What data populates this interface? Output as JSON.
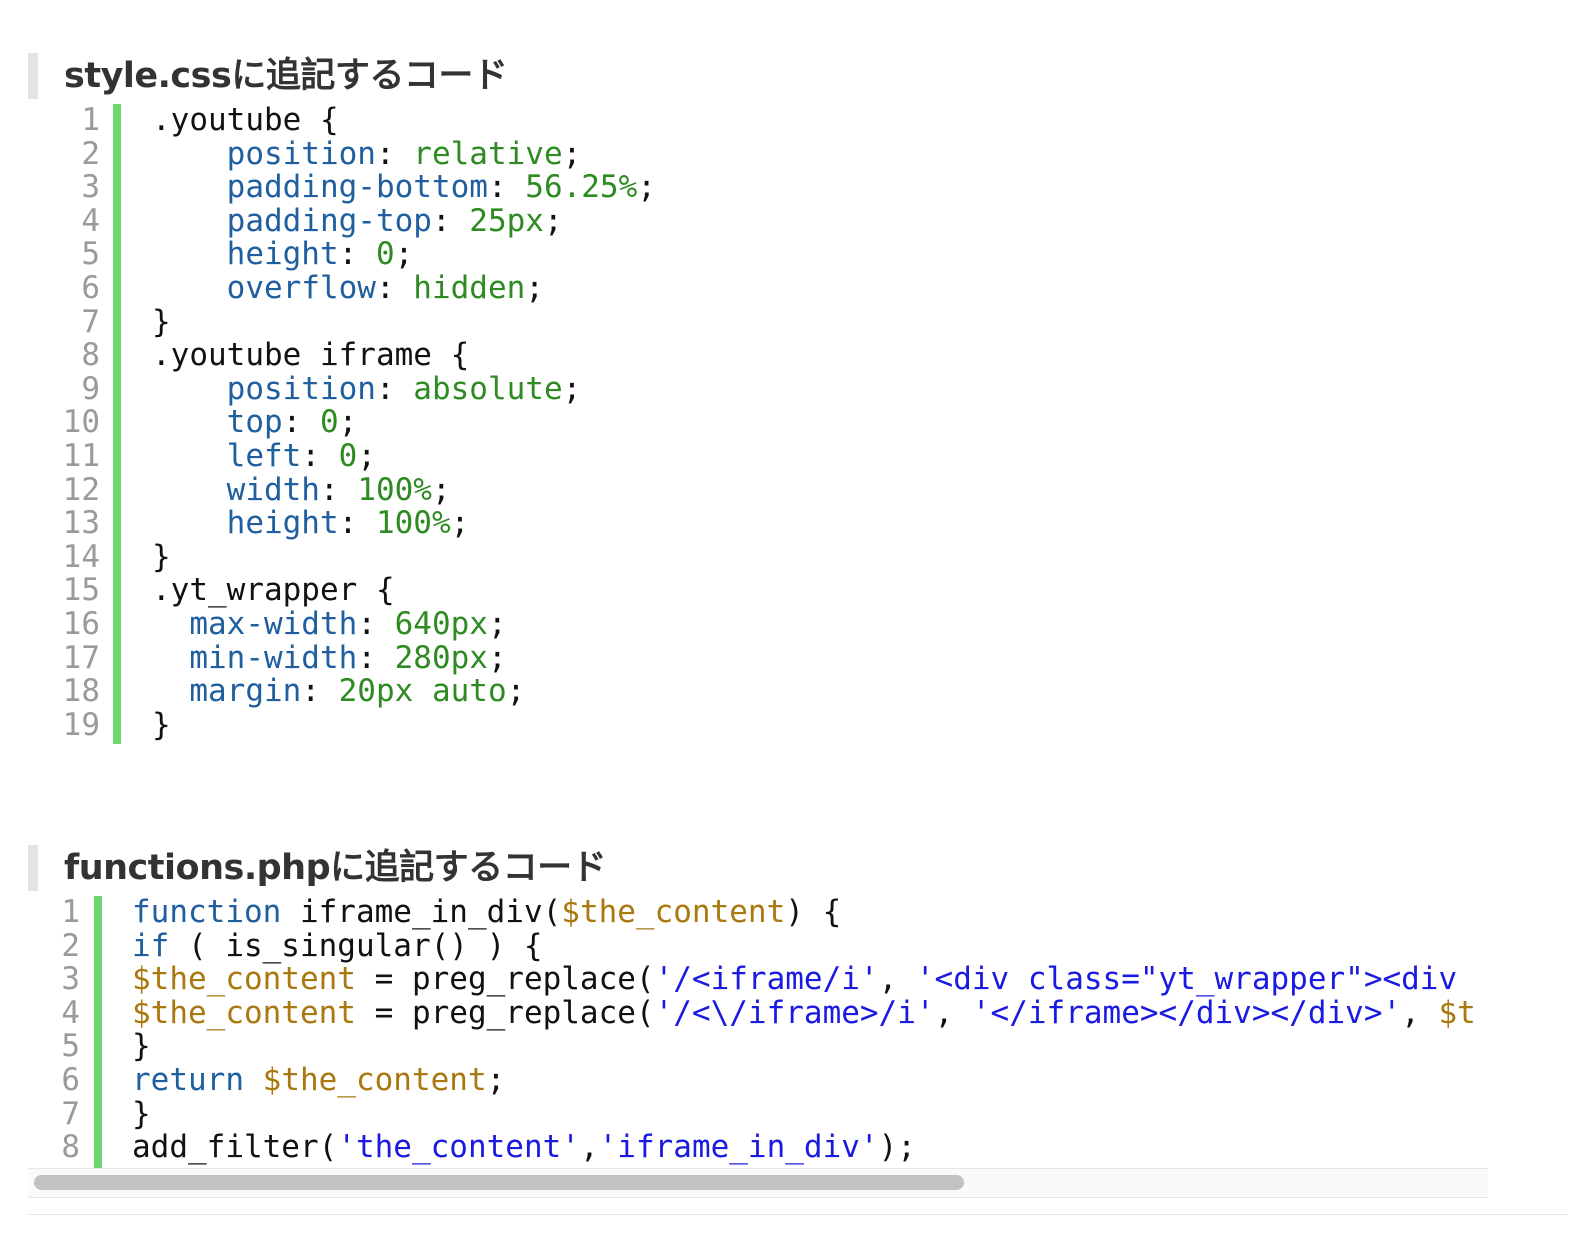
{
  "headings": {
    "css": "style.cssに追記するコード",
    "php": "functions.phpに追記するコード"
  },
  "css_code": {
    "line_numbers": [
      "1",
      "2",
      "3",
      "4",
      "5",
      "6",
      "7",
      "8",
      "9",
      "10",
      "11",
      "12",
      "13",
      "14",
      "15",
      "16",
      "17",
      "18",
      "19"
    ],
    "lines": [
      [
        {
          "t": ".youtube {",
          "c": ""
        }
      ],
      [
        {
          "t": "    ",
          "c": ""
        },
        {
          "t": "position",
          "c": "p"
        },
        {
          "t": ": ",
          "c": ""
        },
        {
          "t": "relative",
          "c": "v"
        },
        {
          "t": ";",
          "c": ""
        }
      ],
      [
        {
          "t": "    ",
          "c": ""
        },
        {
          "t": "padding-bottom",
          "c": "p"
        },
        {
          "t": ": ",
          "c": ""
        },
        {
          "t": "56.25%",
          "c": "v"
        },
        {
          "t": ";",
          "c": ""
        }
      ],
      [
        {
          "t": "    ",
          "c": ""
        },
        {
          "t": "padding-top",
          "c": "p"
        },
        {
          "t": ": ",
          "c": ""
        },
        {
          "t": "25px",
          "c": "v"
        },
        {
          "t": ";",
          "c": ""
        }
      ],
      [
        {
          "t": "    ",
          "c": ""
        },
        {
          "t": "height",
          "c": "p"
        },
        {
          "t": ": ",
          "c": ""
        },
        {
          "t": "0",
          "c": "v"
        },
        {
          "t": ";",
          "c": ""
        }
      ],
      [
        {
          "t": "    ",
          "c": ""
        },
        {
          "t": "overflow",
          "c": "p"
        },
        {
          "t": ": ",
          "c": ""
        },
        {
          "t": "hidden",
          "c": "v"
        },
        {
          "t": ";",
          "c": ""
        }
      ],
      [
        {
          "t": "}",
          "c": ""
        }
      ],
      [
        {
          "t": ".youtube iframe {",
          "c": ""
        }
      ],
      [
        {
          "t": "    ",
          "c": ""
        },
        {
          "t": "position",
          "c": "p"
        },
        {
          "t": ": ",
          "c": ""
        },
        {
          "t": "absolute",
          "c": "v"
        },
        {
          "t": ";",
          "c": ""
        }
      ],
      [
        {
          "t": "    ",
          "c": ""
        },
        {
          "t": "top",
          "c": "p"
        },
        {
          "t": ": ",
          "c": ""
        },
        {
          "t": "0",
          "c": "v"
        },
        {
          "t": ";",
          "c": ""
        }
      ],
      [
        {
          "t": "    ",
          "c": ""
        },
        {
          "t": "left",
          "c": "p"
        },
        {
          "t": ": ",
          "c": ""
        },
        {
          "t": "0",
          "c": "v"
        },
        {
          "t": ";",
          "c": ""
        }
      ],
      [
        {
          "t": "    ",
          "c": ""
        },
        {
          "t": "width",
          "c": "p"
        },
        {
          "t": ": ",
          "c": ""
        },
        {
          "t": "100%",
          "c": "v"
        },
        {
          "t": ";",
          "c": ""
        }
      ],
      [
        {
          "t": "    ",
          "c": ""
        },
        {
          "t": "height",
          "c": "p"
        },
        {
          "t": ": ",
          "c": ""
        },
        {
          "t": "100%",
          "c": "v"
        },
        {
          "t": ";",
          "c": ""
        }
      ],
      [
        {
          "t": "}",
          "c": ""
        }
      ],
      [
        {
          "t": ".yt_wrapper {",
          "c": ""
        }
      ],
      [
        {
          "t": "  ",
          "c": ""
        },
        {
          "t": "max-width",
          "c": "p"
        },
        {
          "t": ": ",
          "c": ""
        },
        {
          "t": "640px",
          "c": "v"
        },
        {
          "t": ";",
          "c": ""
        }
      ],
      [
        {
          "t": "  ",
          "c": ""
        },
        {
          "t": "min-width",
          "c": "p"
        },
        {
          "t": ": ",
          "c": ""
        },
        {
          "t": "280px",
          "c": "v"
        },
        {
          "t": ";",
          "c": ""
        }
      ],
      [
        {
          "t": "  ",
          "c": ""
        },
        {
          "t": "margin",
          "c": "p"
        },
        {
          "t": ": ",
          "c": ""
        },
        {
          "t": "20px auto",
          "c": "v"
        },
        {
          "t": ";",
          "c": ""
        }
      ],
      [
        {
          "t": "}",
          "c": ""
        }
      ]
    ]
  },
  "php_code": {
    "line_numbers": [
      "1",
      "2",
      "3",
      "4",
      "5",
      "6",
      "7",
      "8"
    ],
    "lines": [
      [
        {
          "t": "function",
          "c": "k"
        },
        {
          "t": " iframe_in_div(",
          "c": ""
        },
        {
          "t": "$the_content",
          "c": "var"
        },
        {
          "t": ") {",
          "c": ""
        }
      ],
      [
        {
          "t": "if",
          "c": "k"
        },
        {
          "t": " ( is_singular() ) {",
          "c": ""
        }
      ],
      [
        {
          "t": "$the_content",
          "c": "var"
        },
        {
          "t": " = preg_replace(",
          "c": ""
        },
        {
          "t": "'/<iframe/i'",
          "c": "s"
        },
        {
          "t": ", ",
          "c": ""
        },
        {
          "t": "'<div class=\"yt_wrapper\"><div",
          "c": "s"
        }
      ],
      [
        {
          "t": "$the_content",
          "c": "var"
        },
        {
          "t": " = preg_replace(",
          "c": ""
        },
        {
          "t": "'/<\\/iframe>/i'",
          "c": "s"
        },
        {
          "t": ", ",
          "c": ""
        },
        {
          "t": "'</iframe></div></div>'",
          "c": "s"
        },
        {
          "t": ", ",
          "c": ""
        },
        {
          "t": "$t",
          "c": "var"
        }
      ],
      [
        {
          "t": "}",
          "c": ""
        }
      ],
      [
        {
          "t": "return",
          "c": "k"
        },
        {
          "t": " ",
          "c": ""
        },
        {
          "t": "$the_content",
          "c": "var"
        },
        {
          "t": ";",
          "c": ""
        }
      ],
      [
        {
          "t": "}",
          "c": ""
        }
      ],
      [
        {
          "t": "add_filter(",
          "c": ""
        },
        {
          "t": "'the_content'",
          "c": "s"
        },
        {
          "t": ",",
          "c": ""
        },
        {
          "t": "'iframe_in_div'",
          "c": "s"
        },
        {
          "t": ");",
          "c": ""
        }
      ]
    ]
  },
  "colors": {
    "gutter_bar": "#6ed66e",
    "css_property": "#1f5fa0",
    "css_value": "#2e8b22",
    "php_keyword": "#1f5fa0",
    "php_variable": "#a9780f",
    "php_string": "#1a1ae0"
  }
}
